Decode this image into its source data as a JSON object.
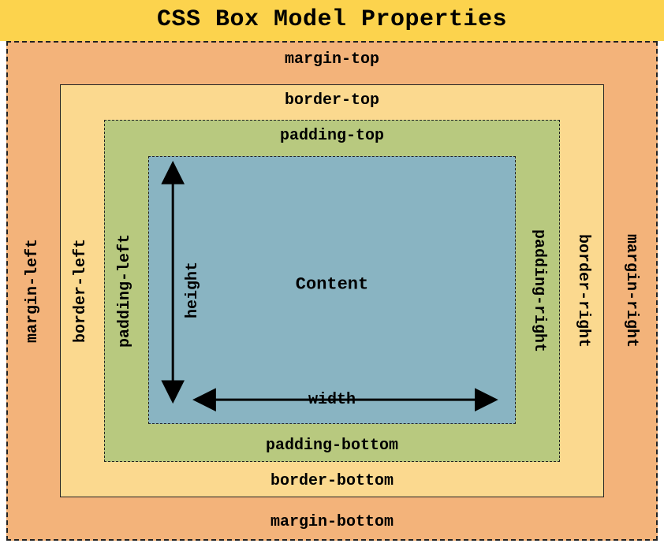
{
  "title": "CSS Box Model Properties",
  "labels": {
    "margin": {
      "top": "margin-top",
      "right": "margin-right",
      "bottom": "margin-bottom",
      "left": "margin-left"
    },
    "border": {
      "top": "border-top",
      "right": "border-right",
      "bottom": "border-bottom",
      "left": "border-left"
    },
    "padding": {
      "top": "padding-top",
      "right": "padding-right",
      "bottom": "padding-bottom",
      "left": "padding-left"
    },
    "content": "Content",
    "width": "width",
    "height": "height"
  },
  "colors": {
    "title_bg": "#fcd34d",
    "margin_bg": "#f3b37a",
    "border_bg": "#fbd98f",
    "padding_bg": "#b8c97f",
    "content_bg": "#89b4c2"
  }
}
